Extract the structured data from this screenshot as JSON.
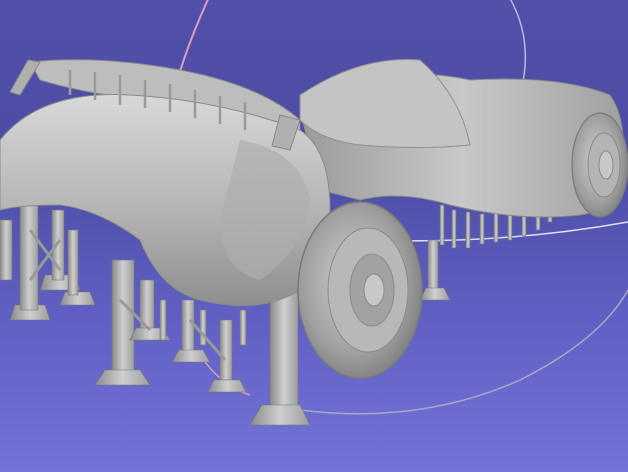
{
  "viewer": {
    "background_top": "#5250a8",
    "background_bottom": "#7474d6",
    "trackball_pink": "#d8a0c0",
    "trackball_white": "#e0e0f0",
    "mesh_light": "#d6d6d6",
    "mesh_mid": "#a8a8a8",
    "mesh_dark": "#7a7a7a"
  },
  "model": {
    "icon": "3d-car-mesh-with-supports",
    "has_support_structures": true
  }
}
